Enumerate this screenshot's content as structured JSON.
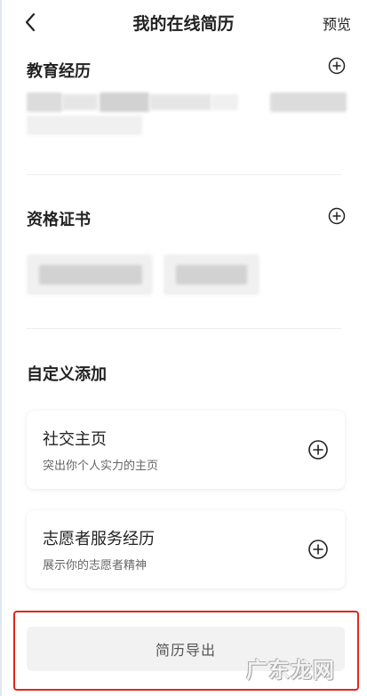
{
  "header": {
    "title": "我的在线简历",
    "preview_label": "预览"
  },
  "sections": {
    "education": {
      "title": "教育经历"
    },
    "certificates": {
      "title": "资格证书"
    },
    "custom": {
      "title": "自定义添加"
    }
  },
  "cards": [
    {
      "title": "社交主页",
      "subtitle": "突出你个人实力的主页"
    },
    {
      "title": "志愿者服务经历",
      "subtitle": "展示你的志愿者精神"
    }
  ],
  "export_button": {
    "label": "简历导出"
  },
  "watermark": "广东龙网",
  "colors": {
    "highlight": "#e1261c",
    "button_bg": "#f2f2f2"
  }
}
